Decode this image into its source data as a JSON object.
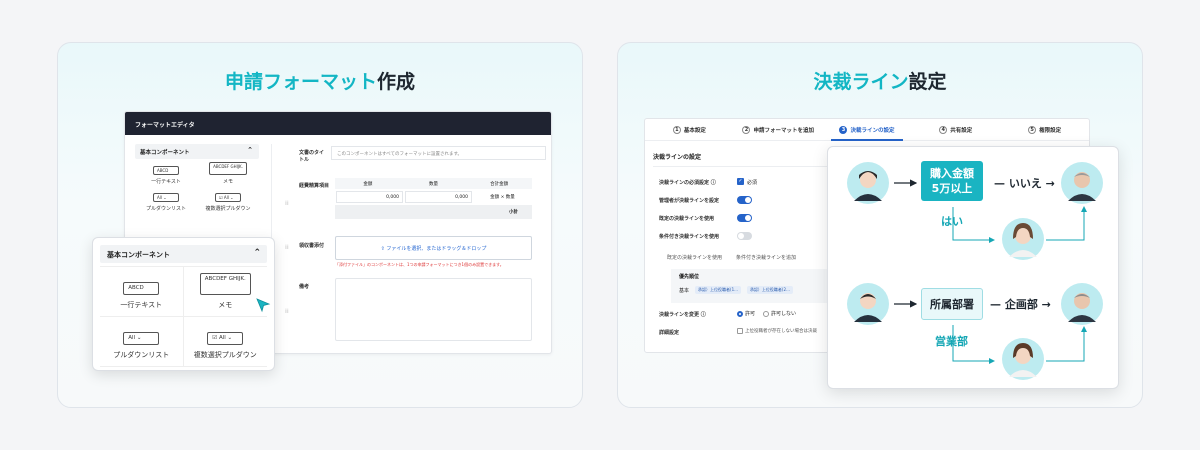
{
  "left_card": {
    "title_accent": "申請フォーマット",
    "title_rest": "作成",
    "editor": {
      "header": "フォーマットエディタ",
      "components_header": "基本コンポーネント",
      "components": [
        {
          "preview": "ABCD",
          "label": "一行テキスト"
        },
        {
          "preview": "ABCDEF GHIJK.",
          "label": "メモ"
        },
        {
          "preview": "All",
          "label": "プルダウンリスト"
        },
        {
          "preview": "All",
          "label": "複数選択プルダウン"
        }
      ],
      "doc_title_label": "文書のタイトル",
      "doc_title_hint": "このコンポーネントはすべてのフォーマットに設置されます。",
      "expense_label": "経費精算項目",
      "table_headers": [
        "金額",
        "数量",
        "合計金額"
      ],
      "table_values": [
        "0,000",
        "0,000",
        "金額 × 数量"
      ],
      "subtotal": "小計",
      "receipt_label": "領収書添付",
      "upload_text": "ファイルを選択、またはドラッグ＆ドロップ",
      "warning": "「添付ファイル」のコンポーネントは、1つの申請フォーマットにつき1個のみ設置できます。",
      "memo_label": "備考"
    },
    "popup": {
      "header": "基本コンポーネント",
      "components": [
        {
          "preview": "ABCD",
          "label": "一行テキスト"
        },
        {
          "preview": "ABCDEF GHIJK.",
          "label": "メモ"
        },
        {
          "preview": "All",
          "label": "プルダウンリスト"
        },
        {
          "preview": "All",
          "label": "複数選択プルダウン"
        }
      ]
    }
  },
  "right_card": {
    "title_accent": "決裁ライン",
    "title_rest": "設定",
    "steps": [
      {
        "num": "1",
        "label": "基本設定"
      },
      {
        "num": "2",
        "label": "申請フォーマットを追加"
      },
      {
        "num": "3",
        "label": "決裁ラインの設定"
      },
      {
        "num": "4",
        "label": "共有設定"
      },
      {
        "num": "5",
        "label": "権限設定"
      }
    ],
    "section_title": "決裁ラインの設定",
    "rows": {
      "required": "決裁ラインの必須設定",
      "required_check": "必須",
      "admin": "管理者が決裁ラインを設定",
      "fixed": "既定の決裁ラインを使用",
      "conditional": "条件付き決裁ラインを使用"
    },
    "subtabs": [
      "既定の決裁ラインを使用",
      "条件付き決裁ラインを追加"
    ],
    "priority_header": "優先順位",
    "priority_row_label": "基本",
    "chips": [
      "承認）上位役職者(1...",
      "承認）上位役職者(2..."
    ],
    "change_label": "決裁ラインを変更",
    "radio_allow": "許可",
    "radio_deny": "許可しない",
    "detail_label": "詳細設定",
    "detail_checkbox": "上位役職者が存在しない場合は決裁"
  },
  "flow": {
    "row1": {
      "box": "購入金額\n5万以上",
      "no": "いいえ",
      "yes": "はい"
    },
    "row2": {
      "box": "所属部署",
      "dept": "企画部",
      "sales": "営業部"
    }
  },
  "colors": {
    "accent": "#13b6c4",
    "primary_blue": "#2563c9",
    "editor_header": "#1f2331"
  }
}
